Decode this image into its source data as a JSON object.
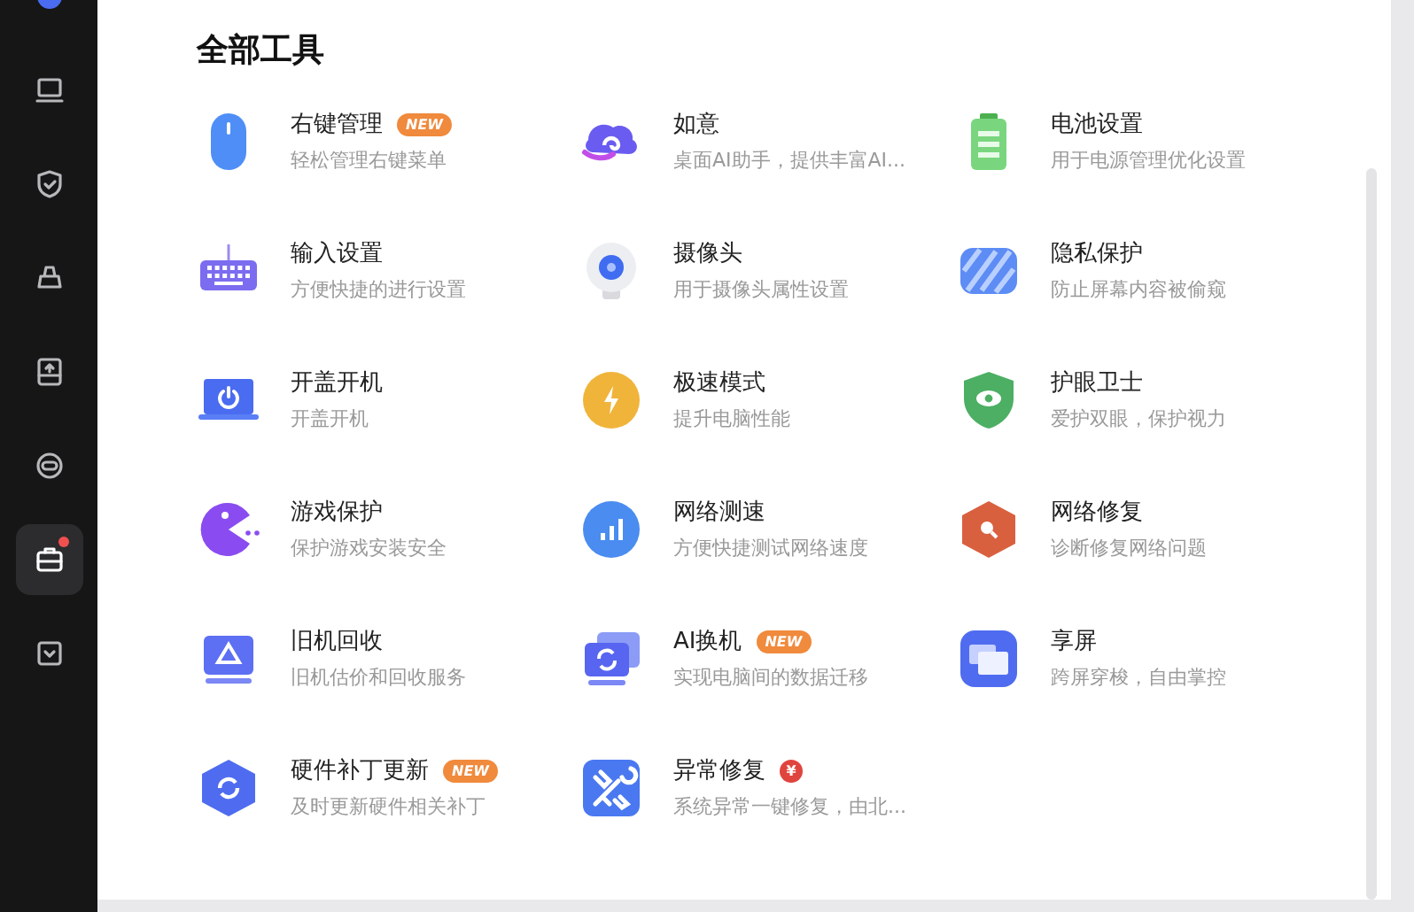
{
  "sidebar": {
    "items": [
      {
        "selected": false,
        "notify": false
      },
      {
        "selected": false,
        "notify": false
      },
      {
        "selected": false,
        "notify": false
      },
      {
        "selected": false,
        "notify": false
      },
      {
        "selected": false,
        "notify": false
      },
      {
        "selected": true,
        "notify": true
      },
      {
        "selected": false,
        "notify": false
      }
    ]
  },
  "title": "全部工具",
  "tools": [
    {
      "name": "右键管理",
      "desc": "轻松管理右键菜单",
      "badge": {
        "kind": "new",
        "text": "NEW"
      }
    },
    {
      "name": "如意",
      "desc": "桌面AI助手，提供丰富AI..."
    },
    {
      "name": "电池设置",
      "desc": "用于电源管理优化设置"
    },
    {
      "name": "输入设置",
      "desc": "方便快捷的进行设置"
    },
    {
      "name": "摄像头",
      "desc": "用于摄像头属性设置"
    },
    {
      "name": "隐私保护",
      "desc": "防止屏幕内容被偷窥"
    },
    {
      "name": "开盖开机",
      "desc": "开盖开机"
    },
    {
      "name": "极速模式",
      "desc": "提升电脑性能"
    },
    {
      "name": "护眼卫士",
      "desc": "爱护双眼，保护视力"
    },
    {
      "name": "游戏保护",
      "desc": "保护游戏安装安全"
    },
    {
      "name": "网络测速",
      "desc": "方便快捷测试网络速度"
    },
    {
      "name": "网络修复",
      "desc": "诊断修复网络问题"
    },
    {
      "name": "旧机回收",
      "desc": "旧机估价和回收服务"
    },
    {
      "name": "AI换机",
      "desc": "实现电脑间的数据迁移",
      "badge": {
        "kind": "new",
        "text": "NEW"
      }
    },
    {
      "name": "享屏",
      "desc": "跨屏穿梭，自由掌控"
    },
    {
      "name": "硬件补丁更新",
      "desc": "及时更新硬件相关补丁",
      "badge": {
        "kind": "new",
        "text": "NEW"
      }
    },
    {
      "name": "异常修复",
      "desc": "系统异常一键修复，由北...",
      "badge": {
        "kind": "paid",
        "text": "¥"
      }
    }
  ]
}
